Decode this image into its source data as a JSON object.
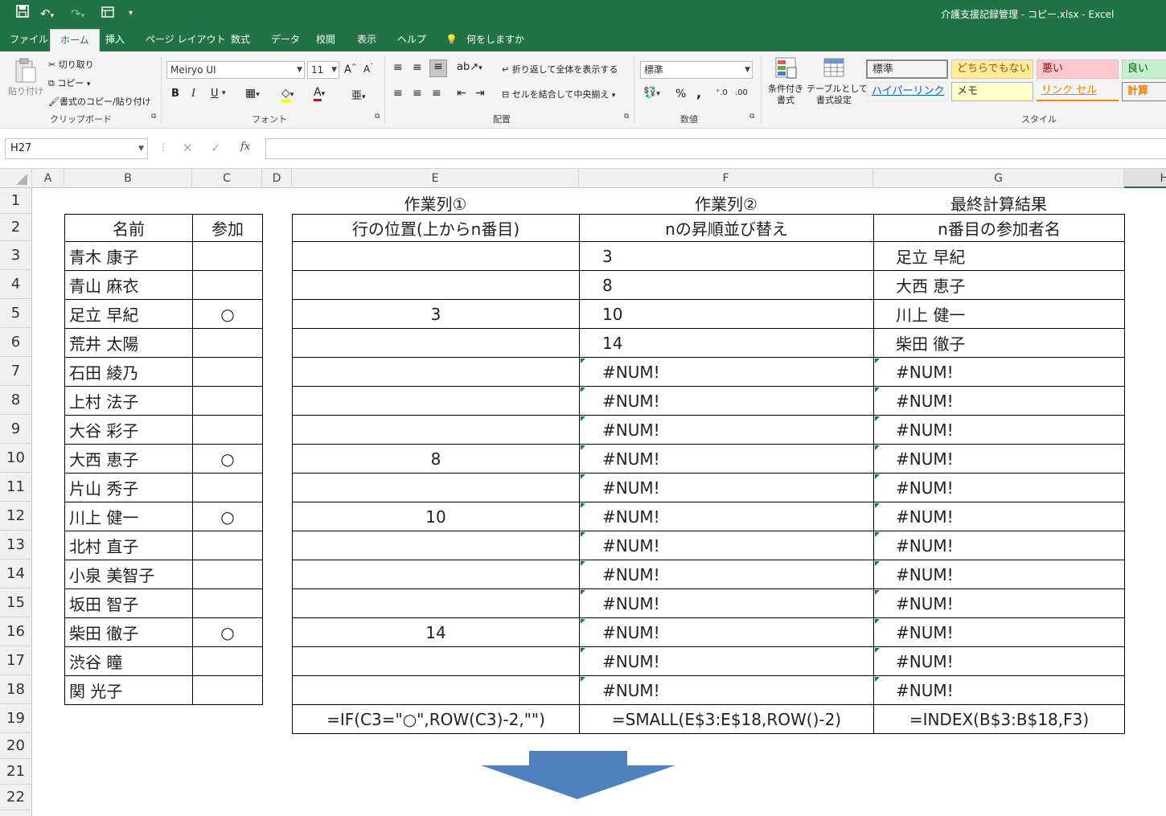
{
  "window": {
    "title": "介護支援記録管理 - コピー.xlsx  -  Excel"
  },
  "tabs": [
    "ファイル",
    "ホーム",
    "挿入",
    "ページ レイアウト",
    "数式",
    "データ",
    "校閲",
    "表示",
    "ヘルプ",
    "何をしますか"
  ],
  "active_tab": "ホーム",
  "ribbon": {
    "clipboard": {
      "paste": "貼り付け",
      "cut": "切り取り",
      "copy": "コピー",
      "format_painter": "書式のコピー/貼り付け",
      "label": "クリップボード"
    },
    "font": {
      "name": "Meiryo UI",
      "size": "11",
      "bold": "B",
      "italic": "I",
      "underline": "U",
      "label": "フォント"
    },
    "alignment": {
      "wrap": "折り返して全体を表示する",
      "merge": "セルを結合して中央揃え",
      "label": "配置"
    },
    "number": {
      "format": "標準",
      "percent": "%",
      "comma": ",",
      "label": "数値"
    },
    "styles": {
      "conditional": "条件付き\n書式",
      "table": "テーブルとして\n書式設定",
      "cells": [
        {
          "text": "標準",
          "color": "#000000",
          "bg": "#ffffff"
        },
        {
          "text": "どちらでもない",
          "color": "#9c5700",
          "bg": "#ffeb9c"
        },
        {
          "text": "悪い",
          "color": "#9c0006",
          "bg": "#ffc7ce"
        },
        {
          "text": "良い",
          "color": "#006100",
          "bg": "#c6efce"
        },
        {
          "text": "ハイパーリンク",
          "color": "#0563c1",
          "bg": "#ffffff"
        },
        {
          "text": "メモ",
          "color": "#000000",
          "bg": "#ffffcc"
        },
        {
          "text": "リンク セル",
          "color": "#fa7d00",
          "bg": "#ffffff"
        },
        {
          "text": "計算",
          "color": "#fa7d00",
          "bg": "#f2f2f2"
        }
      ],
      "label": "スタイル"
    }
  },
  "formula_bar": {
    "name_box": "H27",
    "cancel": "✕",
    "enter": "✓",
    "fx": "fx",
    "value": ""
  },
  "columns": [
    "A",
    "B",
    "C",
    "D",
    "E",
    "F",
    "G",
    "H"
  ],
  "rows": [
    "1",
    "2",
    "3",
    "4",
    "5",
    "6",
    "7",
    "8",
    "9",
    "10",
    "11",
    "12",
    "13",
    "14",
    "15",
    "16",
    "17",
    "18",
    "19",
    "20",
    "21",
    "22"
  ],
  "sheet": {
    "e1": "作業列①",
    "f1": "作業列②",
    "g1": "最終計算結果",
    "left_table": {
      "headers": [
        "名前",
        "参加"
      ],
      "rows": [
        [
          "青木 康子",
          ""
        ],
        [
          "青山 麻衣",
          ""
        ],
        [
          "足立 早紀",
          "○"
        ],
        [
          "荒井 太陽",
          ""
        ],
        [
          "石田 綾乃",
          ""
        ],
        [
          "上村 法子",
          ""
        ],
        [
          "大谷 彩子",
          ""
        ],
        [
          "大西 恵子",
          "○"
        ],
        [
          "片山 秀子",
          ""
        ],
        [
          "川上 健一",
          "○"
        ],
        [
          "北村 直子",
          ""
        ],
        [
          "小泉 美智子",
          ""
        ],
        [
          "坂田 智子",
          ""
        ],
        [
          "柴田 徹子",
          "○"
        ],
        [
          "渋谷 瞳",
          ""
        ],
        [
          "関 光子",
          ""
        ]
      ]
    },
    "right_table": {
      "headers": [
        "行の位置(上からn番目)",
        "nの昇順並び替え",
        "n番目の参加者名"
      ],
      "rows": [
        [
          "",
          "3",
          "足立 早紀"
        ],
        [
          "",
          "8",
          "大西 恵子"
        ],
        [
          "3",
          "10",
          "川上 健一"
        ],
        [
          "",
          "14",
          "柴田 徹子"
        ],
        [
          "",
          "#NUM!",
          "#NUM!"
        ],
        [
          "",
          "#NUM!",
          "#NUM!"
        ],
        [
          "",
          "#NUM!",
          "#NUM!"
        ],
        [
          "8",
          "#NUM!",
          "#NUM!"
        ],
        [
          "",
          "#NUM!",
          "#NUM!"
        ],
        [
          "10",
          "#NUM!",
          "#NUM!"
        ],
        [
          "",
          "#NUM!",
          "#NUM!"
        ],
        [
          "",
          "#NUM!",
          "#NUM!"
        ],
        [
          "",
          "#NUM!",
          "#NUM!"
        ],
        [
          "14",
          "#NUM!",
          "#NUM!"
        ],
        [
          "",
          "#NUM!",
          "#NUM!"
        ],
        [
          "",
          "#NUM!",
          "#NUM!"
        ]
      ],
      "formulas": [
        "=IF(C3=\"○\",ROW(C3)-2,\"\")",
        "=SMALL(E$3:E$18,ROW()-2)",
        "=INDEX(B$3:B$18,F3)"
      ]
    }
  },
  "colors": {
    "excel_green": "#217346",
    "arrow": "#4f81bd",
    "error_triangle": "#1e7a3c"
  }
}
